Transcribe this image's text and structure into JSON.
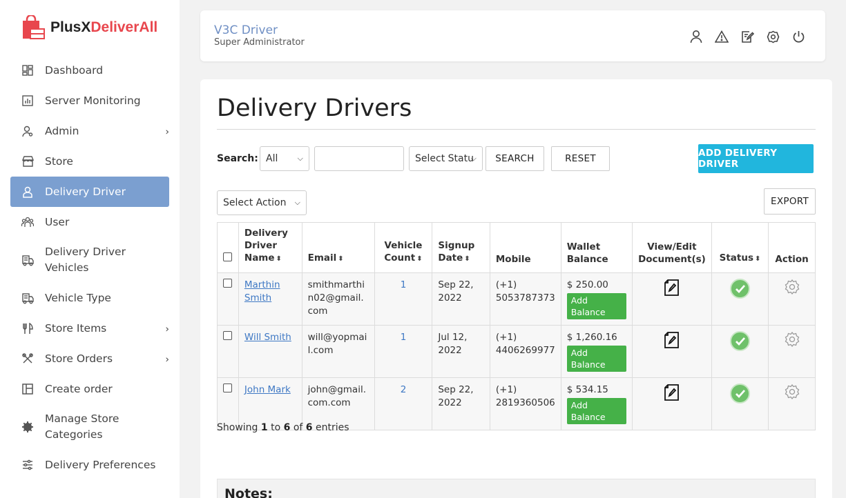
{
  "brand": {
    "name_part1": "PlusX",
    "name_part2": "DeliverAll",
    "accent": "#e8464d"
  },
  "sidebar": {
    "items": [
      {
        "label": "Dashboard",
        "icon": "dashboard-icon"
      },
      {
        "label": "Server Monitoring",
        "icon": "chart-icon"
      },
      {
        "label": "Admin",
        "icon": "admin-user-icon",
        "has_children": true
      },
      {
        "label": "Store",
        "icon": "store-icon"
      },
      {
        "label": "Delivery Driver",
        "icon": "driver-icon",
        "active": true
      },
      {
        "label": "User",
        "icon": "users-icon"
      },
      {
        "label": "Delivery Driver Vehicles",
        "icon": "vehicle-icon"
      },
      {
        "label": "Vehicle Type",
        "icon": "vehicle-type-icon"
      },
      {
        "label": "Store Items",
        "icon": "fork-knife-icon",
        "has_children": true
      },
      {
        "label": "Store Orders",
        "icon": "orders-icon",
        "has_children": true
      },
      {
        "label": "Create order",
        "icon": "create-order-icon"
      },
      {
        "label": "Manage Store Categories",
        "icon": "categories-icon"
      },
      {
        "label": "Delivery Preferences",
        "icon": "preferences-icon"
      }
    ],
    "active_color": "#7b9fd0"
  },
  "header": {
    "title": "V3C Driver",
    "subtitle": "Super Administrator",
    "icons": [
      "profile-icon",
      "alert-icon",
      "edit-icon",
      "settings-icon",
      "power-icon"
    ]
  },
  "page": {
    "title": "Delivery Drivers",
    "search_label": "Search:",
    "search_field_select": "All",
    "search_value": "",
    "status_select": "Select Statu",
    "search_button": "SEARCH",
    "reset_button": "RESET",
    "add_button": "ADD DELIVERY DRIVER",
    "action_select": "Select Action",
    "export_button": "EXPORT",
    "primary_color": "#21b6dd"
  },
  "table": {
    "headers": {
      "name": "Delivery Driver Name",
      "email": "Email",
      "vehicle_count": "Vehicle Count",
      "signup_date": "Signup Date",
      "mobile": "Mobile",
      "wallet_balance": "Wallet Balance",
      "documents": "View/Edit Document(s)",
      "status": "Status",
      "action": "Action"
    },
    "add_balance_label": "Add Balance",
    "rows": [
      {
        "name": "Marthin Smith",
        "email": "smithmarthin02@gmail.com",
        "vehicle_count": "1",
        "signup_date": "Sep 22, 2022",
        "mobile_code": "(+1)",
        "mobile": "5053787373",
        "wallet": "$ 250.00"
      },
      {
        "name": "Will Smith",
        "email": "will@yopmail.com",
        "vehicle_count": "1",
        "signup_date": "Jul 12, 2022",
        "mobile_code": "(+1)",
        "mobile": "4406269977",
        "wallet": "$ 1,260.16"
      },
      {
        "name": "John Mark",
        "email": "john@gmail.com.com",
        "vehicle_count": "2",
        "signup_date": "Sep 22, 2022",
        "mobile_code": "(+1)",
        "mobile": "2819360506",
        "wallet": "$ 534.15"
      }
    ]
  },
  "pagination": {
    "prefix": "Showing",
    "from": "1",
    "to_word": "to",
    "to": "6",
    "of_word": "of",
    "total": "6",
    "suffix": "entries"
  },
  "notes": {
    "title": "Notes:"
  }
}
